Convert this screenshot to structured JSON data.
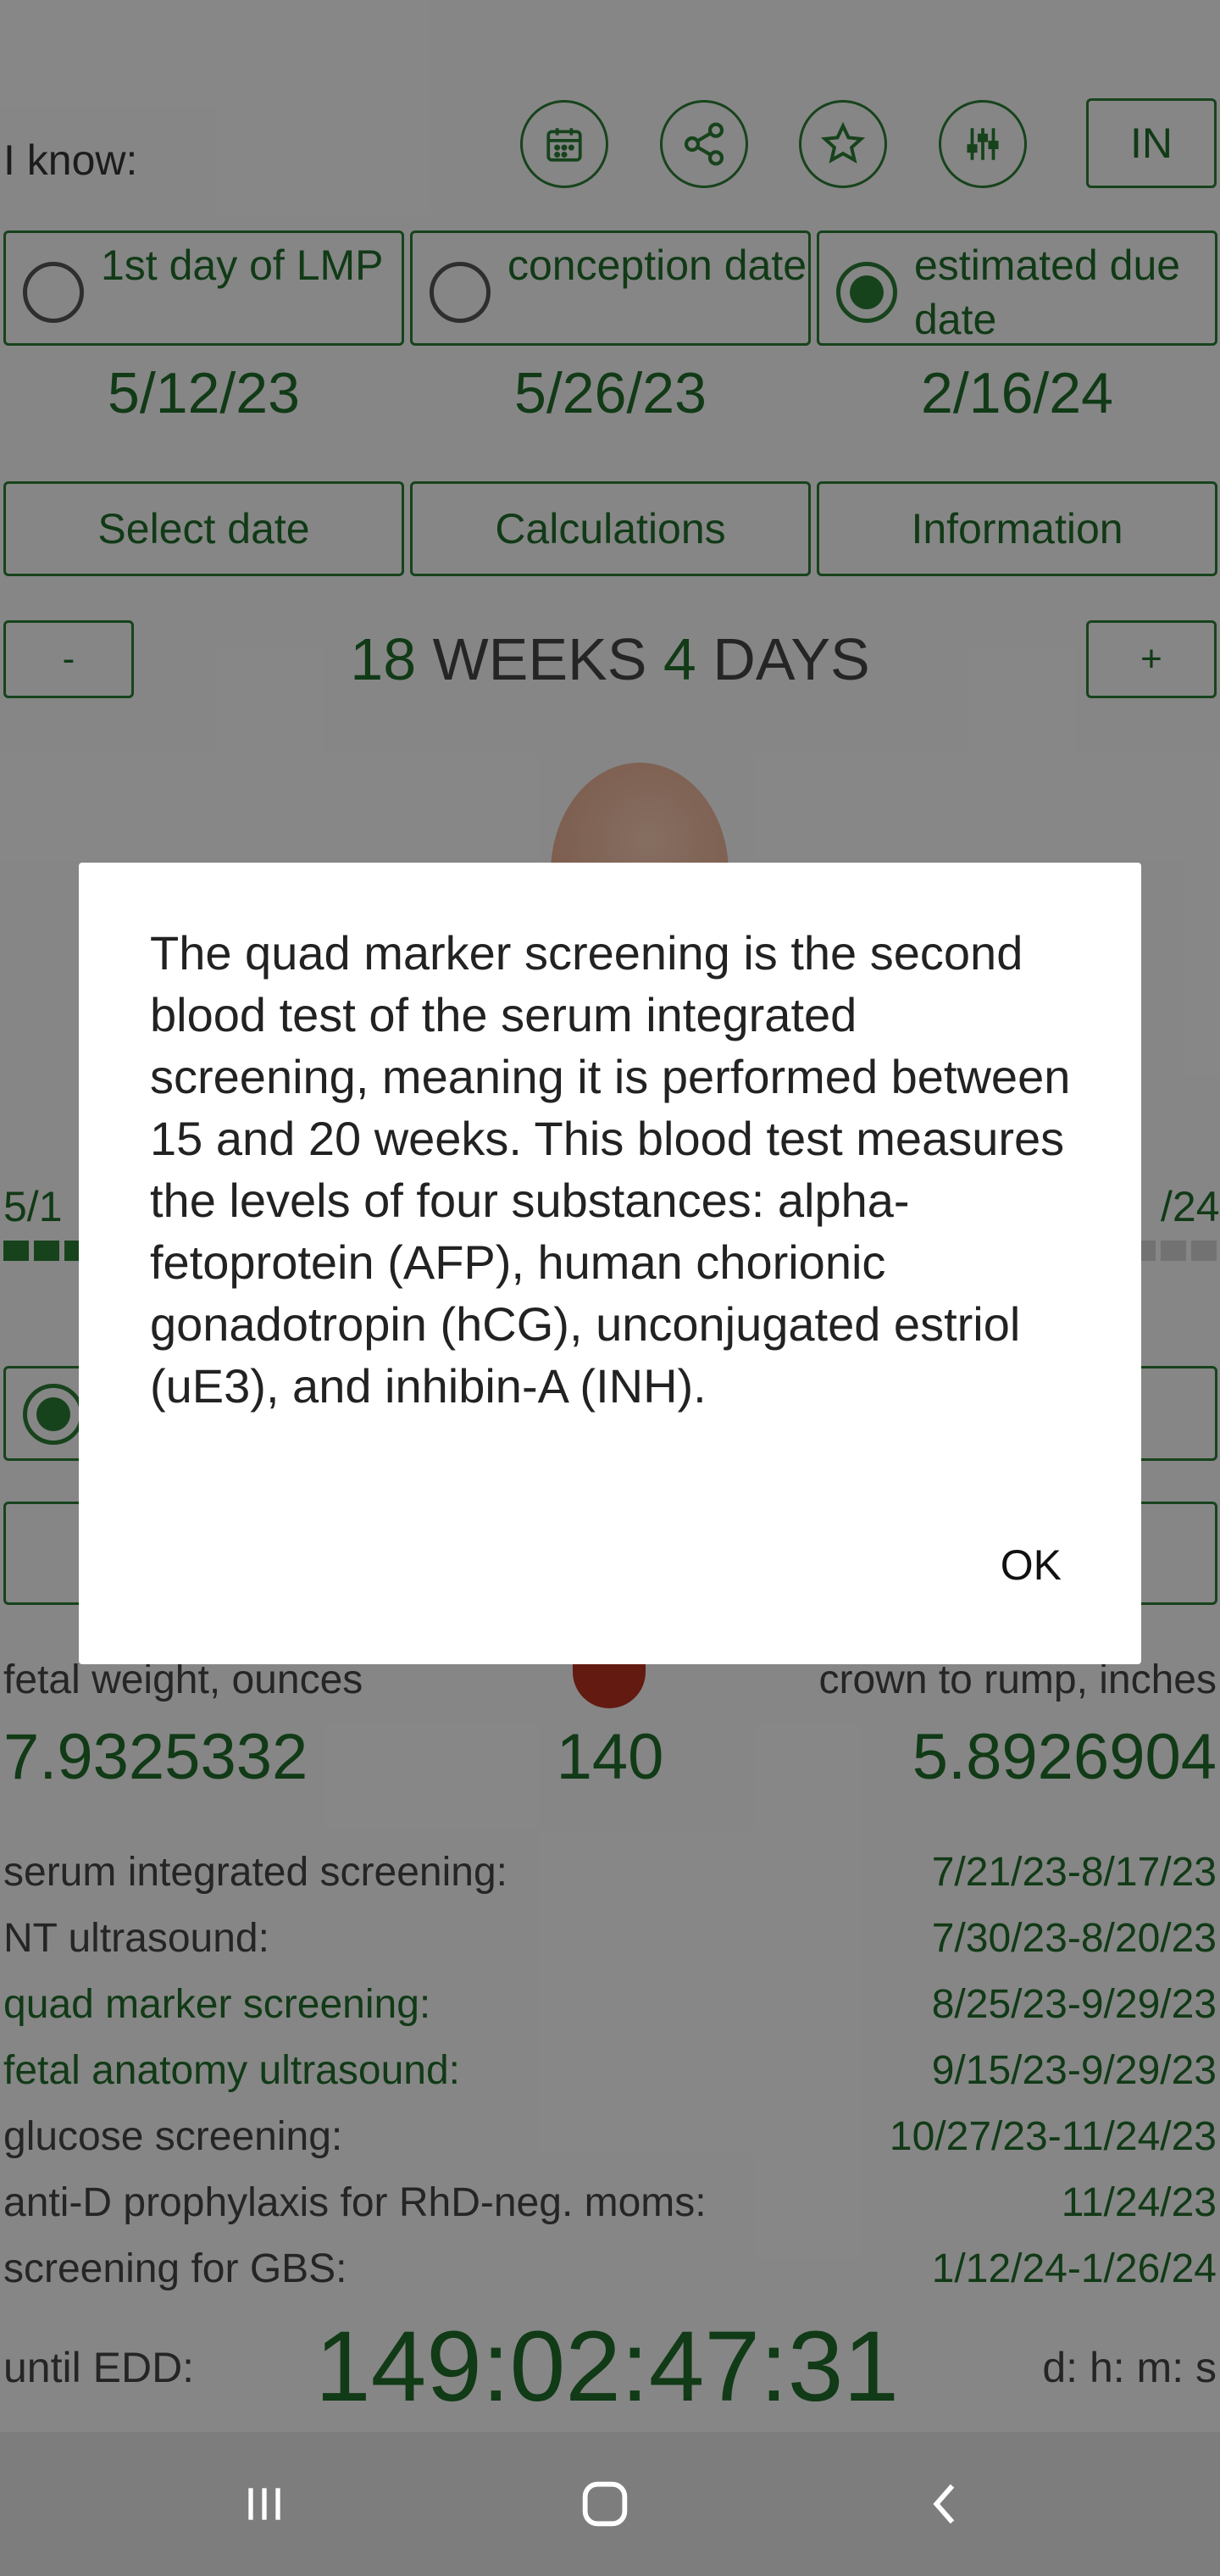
{
  "header": {
    "i_know_label": "I know:",
    "units_button": "IN"
  },
  "radios": [
    {
      "label": "1st day of LMP",
      "selected": false,
      "value": "5/12/23"
    },
    {
      "label": "conception date",
      "selected": false,
      "value": "5/26/23"
    },
    {
      "label": "estimated due date",
      "selected": true,
      "value": "2/16/24"
    }
  ],
  "buttons": {
    "select_date": "Select date",
    "calculations": "Calculations",
    "information": "Information",
    "minus": "-",
    "plus": "+"
  },
  "gestation": {
    "weeks": "18",
    "weeks_word": "WEEKS",
    "days": "4",
    "days_word": "DAYS"
  },
  "progress": {
    "start_label": "5/1",
    "end_label": "/24",
    "fraction": 0.46
  },
  "stats": {
    "weight_label": "fetal weight, ounces",
    "length_label": "crown to rump, inches",
    "weight_value": "7.9325332",
    "heart_rate": "140",
    "length_value": "5.8926904"
  },
  "schedule": [
    {
      "name": "serum integrated screening:",
      "dates": "7/21/23-8/17/23",
      "highlight": false
    },
    {
      "name": "NT ultrasound:",
      "dates": "7/30/23-8/20/23",
      "highlight": false
    },
    {
      "name": "quad marker screening:",
      "dates": "8/25/23-9/29/23",
      "highlight": true
    },
    {
      "name": "fetal anatomy ultrasound:",
      "dates": "9/15/23-9/29/23",
      "highlight": true
    },
    {
      "name": "glucose screening:",
      "dates": "10/27/23-11/24/23",
      "highlight": false
    },
    {
      "name": "anti-D prophylaxis for RhD-neg. moms:",
      "dates": "11/24/23",
      "highlight": false
    },
    {
      "name": "screening for GBS:",
      "dates": "1/12/24-1/26/24",
      "highlight": false
    }
  ],
  "countdown": {
    "label": "until EDD:",
    "value": "149:02:47:31",
    "units": "d: h: m: s"
  },
  "dialog": {
    "message": "The quad marker screening is the second blood test of the serum integrated screening, meaning it is performed between 15 and 20 weeks. This blood test measures the levels of four substances: alpha-fetoprotein (AFP), human chorionic gonadotropin (hCG), unconjugated estriol (uE3), and inhibin-A (INH).",
    "ok_label": "OK"
  },
  "colors": {
    "accent": "#1f6a29",
    "heart": "#b5301f"
  }
}
